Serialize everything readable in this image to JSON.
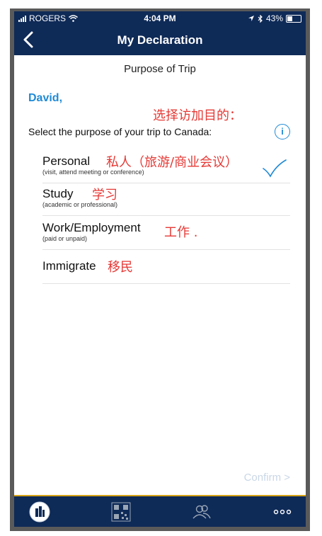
{
  "status": {
    "carrier": "ROGERS",
    "time": "4:04 PM",
    "battery": "43%",
    "battery_level": 0.43
  },
  "nav": {
    "title": "My Declaration"
  },
  "page": {
    "subtitle": "Purpose of Trip",
    "greeting": "David,",
    "cn_heading": "选择访加目的：",
    "prompt": "Select the purpose of your trip to Canada:"
  },
  "options": [
    {
      "label": "Personal",
      "desc": "(visit, attend meeting or conference)",
      "cn": "私人（旅游/商业会议）",
      "selected": true
    },
    {
      "label": "Study",
      "desc": "(academic or professional)",
      "cn": "学习",
      "selected": false
    },
    {
      "label": "Work/Employment",
      "desc": "(paid or unpaid)",
      "cn": "工作 .",
      "selected": false
    },
    {
      "label": "Immigrate",
      "desc": "",
      "cn": "移民",
      "selected": false
    }
  ],
  "confirm_label": "Confirm >",
  "colors": {
    "navy": "#0e2a57",
    "accent_blue": "#1f8ad6",
    "annotation_red": "#e53935",
    "tab_border_gold": "#d6a418"
  },
  "tabbar": {
    "items": [
      "home-icon",
      "qr-code-icon",
      "people-icon",
      "more-icon"
    ]
  }
}
